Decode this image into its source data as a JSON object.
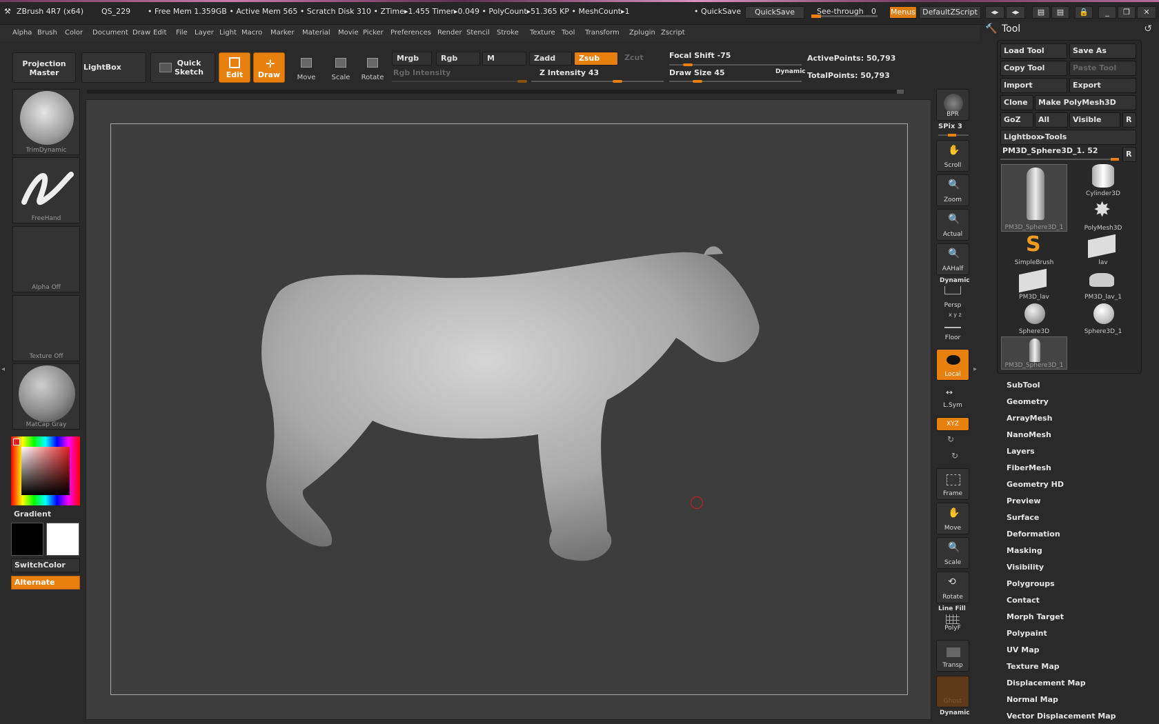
{
  "titlebar": {
    "app": "ZBrush 4R7 (x64)",
    "qs": "QS_229",
    "stats": "• Free Mem 1.359GB • Active Mem 565 • Scratch Disk 310 • ZTime▸1.455 Timer▸0.049 • PolyCount▸51.365 KP • MeshCount▸1",
    "quicksave_label": "• QuickSave",
    "quicksave_btn": "QuickSave",
    "seethrough": "See-through",
    "seethrough_value": "0",
    "menus_btn": "Menus",
    "script_btn": "DefaultZScript"
  },
  "menubar": [
    "Alpha",
    "Brush",
    "Color",
    "Document",
    "Draw",
    "Edit",
    "File",
    "Layer",
    "Light",
    "Macro",
    "Marker",
    "Material",
    "Movie",
    "Picker",
    "Preferences",
    "Render",
    "Stencil",
    "Stroke",
    "Texture",
    "Tool",
    "Transform",
    "Zplugin",
    "Zscript"
  ],
  "shelf": {
    "projection_master": "Projection Master",
    "lightbox": "LightBox",
    "quick_sketch": "Quick Sketch",
    "edit": "Edit",
    "draw": "Draw",
    "move": "Move",
    "scale": "Scale",
    "rotate": "Rotate",
    "mrgb": "Mrgb",
    "rgb": "Rgb",
    "m": "M",
    "zadd": "Zadd",
    "zsub": "Zsub",
    "zcut": "Zcut",
    "rgb_intensity": "Rgb Intensity",
    "z_intensity": "Z Intensity 43",
    "focal_shift": "Focal Shift -75",
    "draw_size": "Draw Size 45",
    "dynamic": "Dynamic",
    "active_points": "ActivePoints: 50,793",
    "total_points": "TotalPoints: 50,793"
  },
  "left_panel": {
    "brush_thumb": "TrimDynamic",
    "stroke_thumb": "FreeHand",
    "alpha_thumb": "Alpha Off",
    "texture_thumb": "Texture Off",
    "material_thumb": "MatCap Gray",
    "gradient": "Gradient",
    "switch_color": "SwitchColor",
    "alternate": "Alternate"
  },
  "right_shelf": {
    "bpr": "BPR",
    "spix": "SPix 3",
    "scroll": "Scroll",
    "zoom": "Zoom",
    "actual": "Actual",
    "aahalf": "AAHalf",
    "dynamic": "Dynamic",
    "persp": "Persp",
    "floor": "Floor",
    "floor_axes": "x y z",
    "local": "Local",
    "lsym": "L.Sym",
    "xyz": "XYZ",
    "frame": "Frame",
    "move": "Move",
    "scale": "Scale",
    "rotate": "Rotate",
    "line_fill": "Line Fill",
    "polyf": "PolyF",
    "transp": "Transp",
    "ghost": "Ghost",
    "dynamic2": "Dynamic"
  },
  "tool_palette": {
    "title": "Tool",
    "load_tool": "Load Tool",
    "save_as": "Save As",
    "copy_tool": "Copy Tool",
    "paste_tool": "Paste Tool",
    "import": "Import",
    "export": "Export",
    "clone": "Clone",
    "make_polymesh": "Make PolyMesh3D",
    "goz": "GoZ",
    "all": "All",
    "visible": "Visible",
    "r": "R",
    "lightbox_tools": "Lightbox▸Tools",
    "current_tool": "PM3D_Sphere3D_1. 52",
    "tools": [
      "PM3D_Sphere3D_1",
      "Cylinder3D",
      "PolyMesh3D",
      "SimpleBrush",
      "lav",
      "PM3D_lav",
      "PM3D_lav_1",
      "Sphere3D",
      "Sphere3D_1",
      "PM3D_Sphere3D_1"
    ],
    "sections": [
      "SubTool",
      "Geometry",
      "ArrayMesh",
      "NanoMesh",
      "Layers",
      "FiberMesh",
      "Geometry HD",
      "Preview",
      "Surface",
      "Deformation",
      "Masking",
      "Visibility",
      "Polygroups",
      "Contact",
      "Morph Target",
      "Polypaint",
      "UV Map",
      "Texture Map",
      "Displacement Map",
      "Normal Map",
      "Vector Displacement Map"
    ]
  },
  "colors": {
    "accent": "#e8800f",
    "background": "#2a2a2a",
    "viewport": "#3d3d3d"
  }
}
